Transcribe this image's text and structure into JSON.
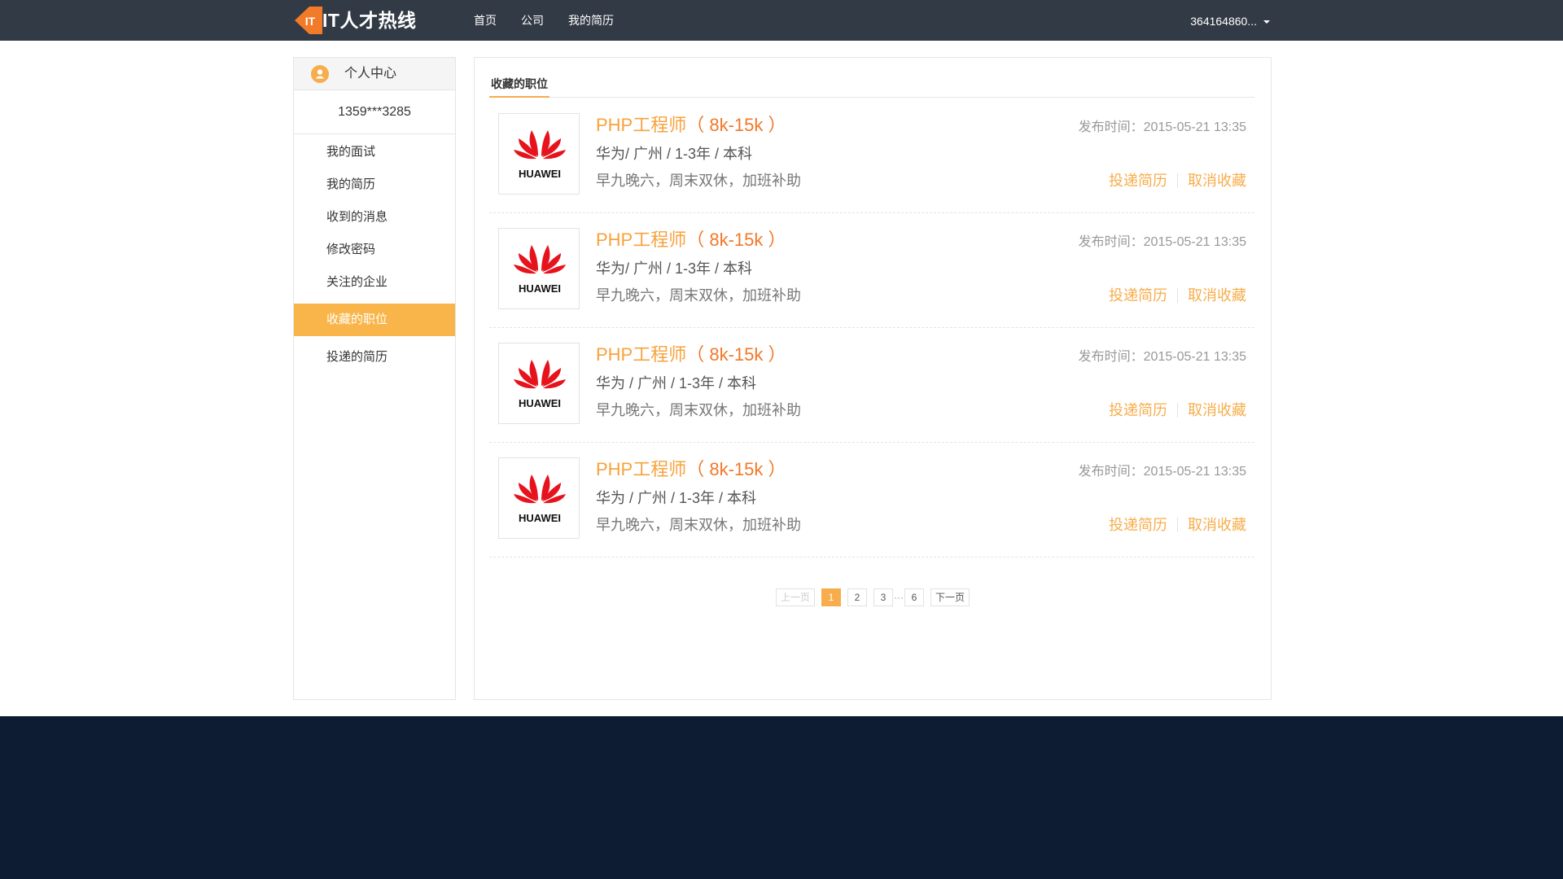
{
  "brand": {
    "logo_letters": "IT",
    "name": "IT人才热线",
    "accent": "#f27b29"
  },
  "nav": {
    "items": [
      "首页",
      "公司",
      "我的简历"
    ]
  },
  "user": {
    "account": "364164860..."
  },
  "sidebar": {
    "title": "个人中心",
    "phone": "1359***3285",
    "items": [
      "我的面试",
      "我的简历",
      "收到的消息",
      "修改密码",
      "关注的企业",
      "收藏的职位",
      "投递的简历"
    ],
    "active_index": 5
  },
  "main": {
    "tab": "收藏的职位",
    "jobs": [
      {
        "logo": "HUAWEI",
        "title": "PHP工程师",
        "salary": "（ 8k-15k ）",
        "meta": "华为/ 广州 / 1-3年 / 本科",
        "desc": "早九晚六，周末双休，加班补助",
        "time": "发布时间：2015-05-21 13:35",
        "apply": "投递简历",
        "cancel": "取消收藏"
      },
      {
        "logo": "HUAWEI",
        "title": "PHP工程师",
        "salary": "（ 8k-15k ）",
        "meta": "华为/ 广州 / 1-3年 / 本科",
        "desc": "早九晚六，周末双休，加班补助",
        "time": "发布时间：2015-05-21 13:35",
        "apply": "投递简历",
        "cancel": "取消收藏"
      },
      {
        "logo": "HUAWEI",
        "title": "PHP工程师",
        "salary": "（ 8k-15k ）",
        "meta": "华为 / 广州 / 1-3年 / 本科",
        "desc": "早九晚六，周末双休，加班补助",
        "time": "发布时间：2015-05-21 13:35",
        "apply": "投递简历",
        "cancel": "取消收藏"
      },
      {
        "logo": "HUAWEI",
        "title": "PHP工程师",
        "salary": "（ 8k-15k ）",
        "meta": "华为 / 广州 / 1-3年 / 本科",
        "desc": "早九晚六，周末双休，加班补助",
        "time": "发布时间：2015-05-21 13:35",
        "apply": "投递简历",
        "cancel": "取消收藏"
      }
    ],
    "pager": {
      "prev": "上一页",
      "pages": [
        "1",
        "2",
        "3"
      ],
      "ellipsis": "···",
      "last": "6",
      "next": "下一页",
      "current": "1"
    }
  },
  "colors": {
    "topbar": "#323a45",
    "accent": "#f7ad4b",
    "salary": "#f2782a",
    "footer": "#0d1b33"
  }
}
